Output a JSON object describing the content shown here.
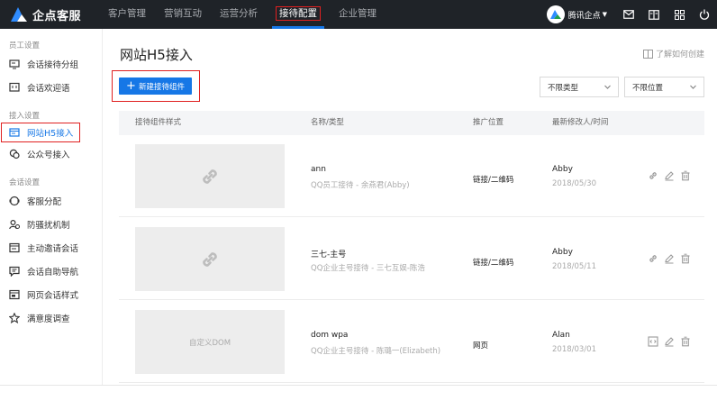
{
  "app": {
    "brand_name": "企点客服",
    "nav": [
      {
        "label": "客户管理"
      },
      {
        "label": "营销互动"
      },
      {
        "label": "运营分析"
      },
      {
        "label": "接待配置"
      },
      {
        "label": "企业管理"
      }
    ],
    "tenant_name": "腾讯企点",
    "accent_color": "#1677e6",
    "highlight_color": "#e02020"
  },
  "sidebar": {
    "groups": [
      {
        "title": "员工设置",
        "items": [
          {
            "label": "会话接待分组",
            "icon": "team-list-icon"
          },
          {
            "label": "会话欢迎语",
            "icon": "welcome-message-icon"
          }
        ]
      },
      {
        "title": "接入设置",
        "items": [
          {
            "label": "网站H5接入",
            "icon": "website-icon"
          },
          {
            "label": "公众号接入",
            "icon": "wechat-icon"
          }
        ]
      },
      {
        "title": "会话设置",
        "items": [
          {
            "label": "客服分配",
            "icon": "distribution-icon"
          },
          {
            "label": "防骚扰机制",
            "icon": "anti-harassment-icon"
          },
          {
            "label": "主动邀请会话",
            "icon": "invite-icon"
          },
          {
            "label": "会话自助导航",
            "icon": "self-navigation-icon"
          },
          {
            "label": "网页会话样式",
            "icon": "web-style-icon"
          },
          {
            "label": "满意度调查",
            "icon": "satisfaction-icon"
          }
        ]
      }
    ]
  },
  "main": {
    "title": "网站H5接入",
    "learn_link": "了解如何创建",
    "new_button": "新建接待组件",
    "filter_type": "不限类型",
    "filter_position": "不限位置",
    "columns": [
      "接待组件样式",
      "名称/类型",
      "推广位置",
      "最新修改人/时间"
    ],
    "rows": [
      {
        "thumb": "",
        "thumb_icon": "link-icon",
        "name": "ann",
        "subtype": "QQ员工接待 - 余燕君(Abby)",
        "channel": "链接/二维码",
        "modifier": "Abby",
        "time": "2018/05/30",
        "first_action_icon": "link-icon"
      },
      {
        "thumb": "",
        "thumb_icon": "link-icon",
        "name": "三七-主号",
        "subtype": "QQ企业主号接待 - 三七互娱-陈浩",
        "channel": "链接/二维码",
        "modifier": "Abby",
        "time": "2018/05/11",
        "first_action_icon": "link-icon"
      },
      {
        "thumb": "自定义DOM",
        "thumb_icon": "",
        "name": "dom wpa",
        "subtype": "QQ企业主号接待 - 陈璐一(Elizabeth)",
        "channel": "网页",
        "modifier": "Alan",
        "time": "2018/03/01",
        "first_action_icon": "code-icon"
      }
    ]
  }
}
